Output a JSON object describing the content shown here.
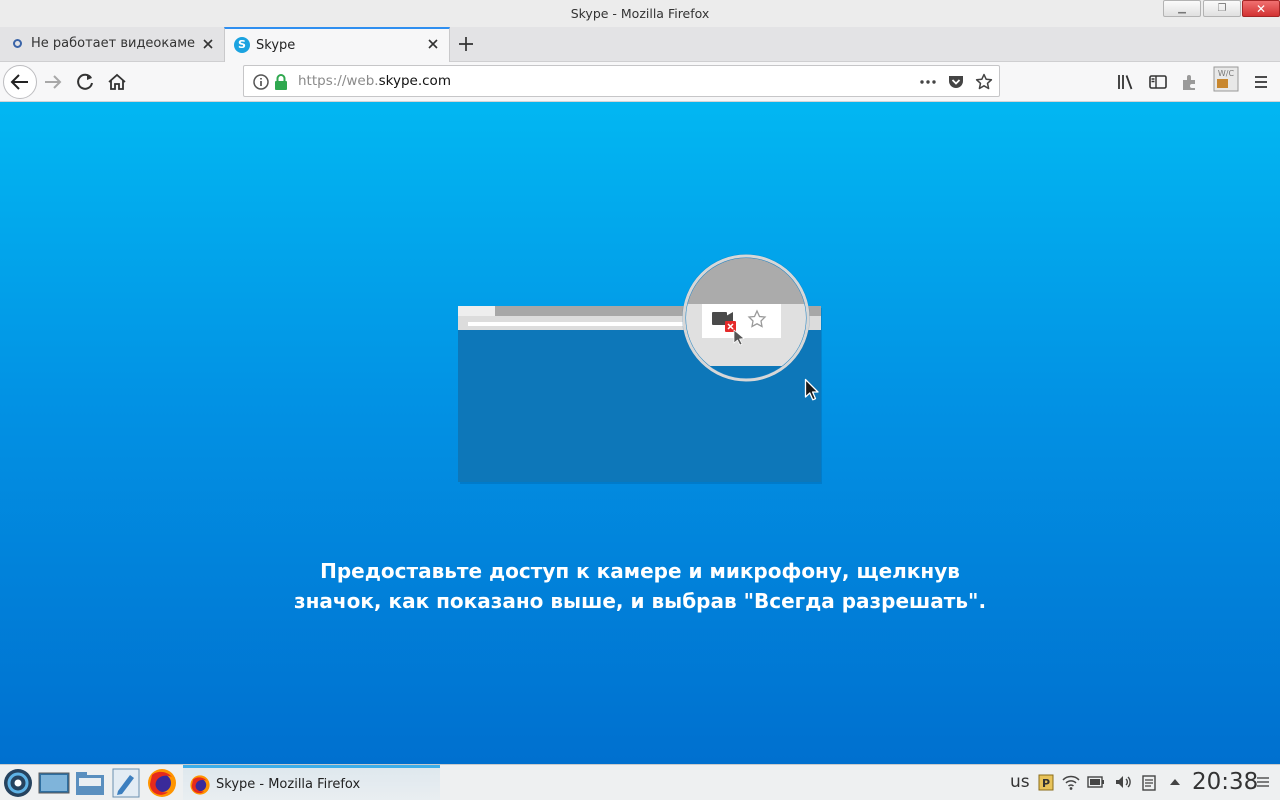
{
  "window": {
    "title": "Skype - Mozilla Firefox"
  },
  "tabs": [
    {
      "label": "Не работает видеокамера",
      "active": false
    },
    {
      "label": "Skype",
      "active": true
    }
  ],
  "addressbar": {
    "url_prefix": "https://web.",
    "url_host": "skype.com"
  },
  "illustration": {
    "mini_toolbar_icons": [
      "camera-blocked-icon",
      "star-icon"
    ]
  },
  "content": {
    "message": "Предоставьте доступ к камере и микрофону, щелкнув\nзначок, как показано выше, и выбрав \"Всегда разрешать\"."
  },
  "taskbar": {
    "window_label": "Skype - Mozilla Firefox",
    "keyboard_layout": "us",
    "clock": "20:38"
  },
  "colors": {
    "content_top": "#02b7f2",
    "content_bottom": "#0070cf",
    "tab_accent": "#2f8ff0",
    "secure_lock": "#2fa84f"
  }
}
